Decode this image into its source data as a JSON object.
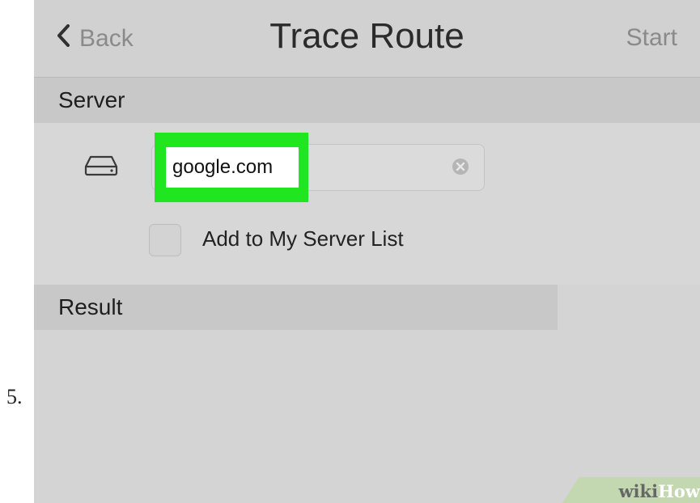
{
  "step_number": "5.",
  "navbar": {
    "back_label": "Back",
    "title": "Trace Route",
    "start_label": "Start"
  },
  "server_section": {
    "header": "Server",
    "field_value": "google.com",
    "add_to_list_label": "Add to My Server List"
  },
  "result_section": {
    "header": "Result"
  },
  "watermark": {
    "wiki": "wiki",
    "how": "How"
  },
  "icons": {
    "back": "chevron-left-icon",
    "server": "hard-drive-icon",
    "clear": "clear-x-icon"
  },
  "colors": {
    "highlight": "#1fe61f"
  }
}
